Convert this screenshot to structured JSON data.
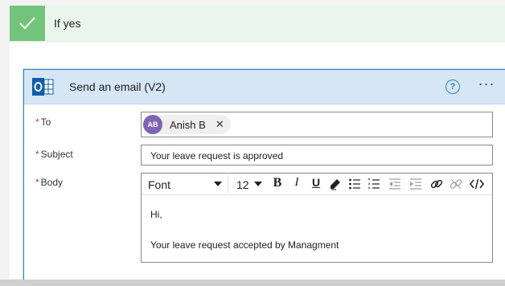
{
  "branch": {
    "label": "If yes",
    "accent_color": "#72c47a"
  },
  "action": {
    "title": "Send an email (V2)",
    "help_symbol": "?",
    "more_symbol": "···",
    "icon": "outlook-icon",
    "header_color": "#d6e6f5"
  },
  "fields": {
    "required_marker": "*",
    "to": {
      "label": "To",
      "recipient": {
        "initials": "AB",
        "name": "Anish B",
        "remove_symbol": "✕",
        "avatar_color": "#8164b3"
      }
    },
    "subject": {
      "label": "Subject",
      "value": "Your leave request is approved"
    },
    "body": {
      "label": "Body",
      "toolbar": {
        "font": "Font",
        "size": "12",
        "bold": "B",
        "italic": "I",
        "underline": "U"
      },
      "lines": [
        "Hi,",
        "Your leave request accepted by Managment"
      ]
    }
  }
}
